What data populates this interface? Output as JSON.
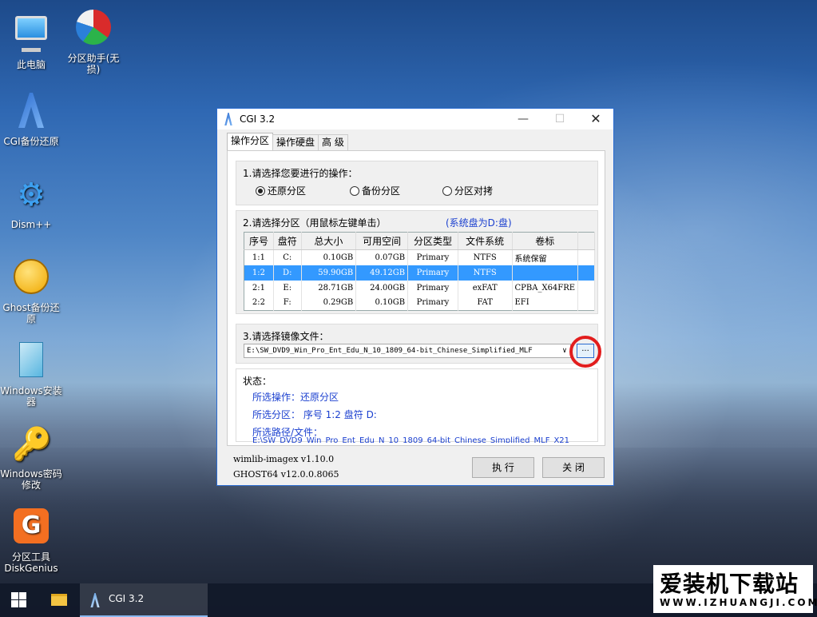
{
  "desktop": {
    "icons": [
      {
        "label": "此电脑"
      },
      {
        "label": "分区助手(无损)"
      },
      {
        "label": "CGI备份还原"
      },
      {
        "label": "Dism++"
      },
      {
        "label": "Ghost备份还原"
      },
      {
        "label": "Windows安装器"
      },
      {
        "label": "Windows密码修改"
      },
      {
        "label": "分区工具DiskGenius"
      }
    ]
  },
  "window": {
    "title": "CGI 3.2",
    "min": "—",
    "max": "☐",
    "close": "✕",
    "tabs": [
      "操作分区",
      "操作硬盘",
      "高 级"
    ],
    "step1": {
      "title": "1.请选择您要进行的操作：",
      "options": [
        "还原分区",
        "备份分区",
        "分区对拷"
      ],
      "selected": "还原分区"
    },
    "step2": {
      "title": "2.请选择分区（用鼠标左键单击）",
      "system_disk": "(系统盘为D:盘)",
      "columns": [
        "序号",
        "盘符",
        "总大小",
        "可用空间",
        "分区类型",
        "文件系统",
        "卷标"
      ],
      "rows": [
        [
          "1:1",
          "C:",
          "0.10GB",
          "0.07GB",
          "Primary",
          "NTFS",
          "系统保留"
        ],
        [
          "1:2",
          "D:",
          "59.90GB",
          "49.12GB",
          "Primary",
          "NTFS",
          ""
        ],
        [
          "2:1",
          "E:",
          "28.71GB",
          "24.00GB",
          "Primary",
          "exFAT",
          "CPBA_X64FRE"
        ],
        [
          "2:2",
          "F:",
          "0.29GB",
          "0.10GB",
          "Primary",
          "FAT",
          "EFI"
        ]
      ],
      "selected_row": 1
    },
    "step3": {
      "title": "3.请选择镜像文件：",
      "path": "E:\\SW_DVD9_Win_Pro_Ent_Edu_N_10_1809_64-bit_Chinese_Simplified_MLF",
      "dropdown_arrow": "∨",
      "browse_label": "..."
    },
    "status": {
      "title": "状态：",
      "op": "所选操作：还原分区",
      "part": "所选分区：  序号 1:2        盘符 D:",
      "path": "所选路径/文件：",
      "path_value": "E:\\SW_DVD9_Win_Pro_Ent_Edu_N_10_1809_64-bit_Chinese_Simplified_MLF_X21"
    },
    "versions": [
      "wimlib-imagex v1.10.0",
      "GHOST64 v12.0.0.8065"
    ],
    "execute_label": "执 行",
    "close_label": "关 闭"
  },
  "taskbar": {
    "app_label": "CGI 3.2"
  },
  "watermark": {
    "big": "爱装机下载站",
    "small": "WWW.IZHUANGJI.COM"
  },
  "colors": {
    "accent": "#2a6bd0",
    "selection": "#3399ff",
    "status_text": "#1a3fcf",
    "highlight_ring": "#e21d1d"
  }
}
